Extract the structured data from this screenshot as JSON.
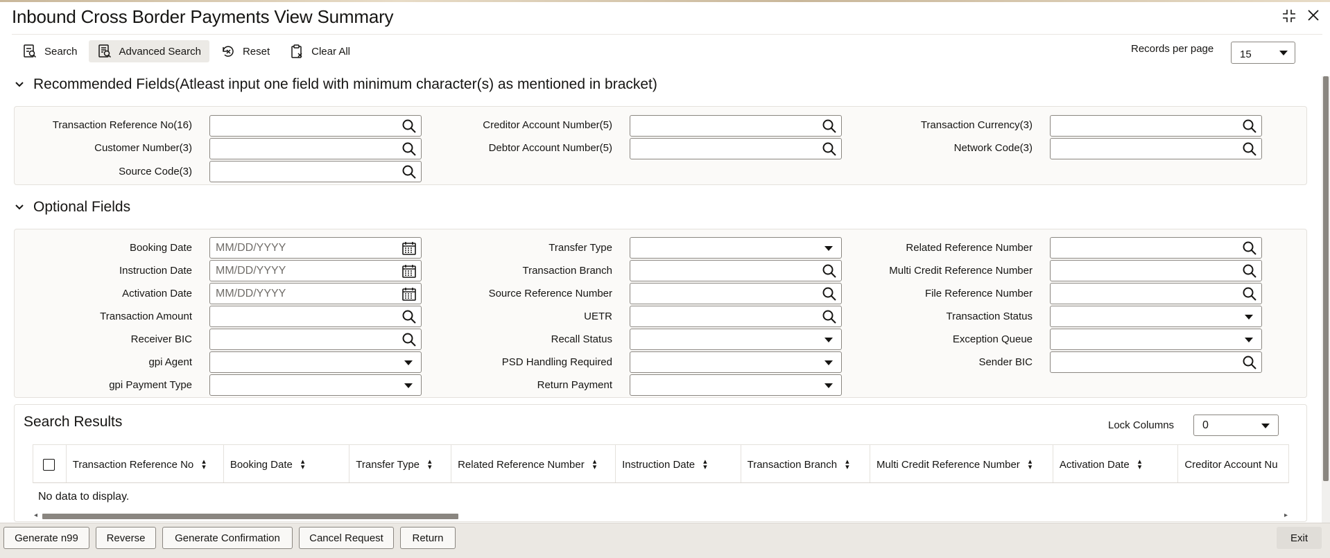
{
  "header": {
    "title": "Inbound Cross Border Payments View Summary",
    "minimize_icon": "collapse-icon",
    "close_icon": "close-icon"
  },
  "toolbar": {
    "search": "Search",
    "advanced_search": "Advanced Search",
    "reset": "Reset",
    "clear_all": "Clear All",
    "records_per_page_label": "Records per page",
    "records_per_page_value": "15"
  },
  "recommended": {
    "title": "Recommended Fields(Atleast input one field with minimum character(s) as mentioned in bracket)",
    "fields": {
      "txn_ref": "Transaction Reference No(16)",
      "customer_no": "Customer Number(3)",
      "source_code": "Source Code(3)",
      "creditor_acc": "Creditor Account Number(5)",
      "debtor_acc": "Debtor Account Number(5)",
      "txn_currency": "Transaction Currency(3)",
      "network_code": "Network Code(3)"
    }
  },
  "optional": {
    "title": "Optional Fields",
    "fields": {
      "booking_date": "Booking Date",
      "instruction_date": "Instruction Date",
      "activation_date": "Activation Date",
      "txn_amount": "Transaction Amount",
      "receiver_bic": "Receiver BIC",
      "gpi_agent": "gpi Agent",
      "gpi_payment_type": "gpi Payment Type",
      "transfer_type": "Transfer Type",
      "txn_branch": "Transaction Branch",
      "source_ref": "Source Reference Number",
      "uetr": "UETR",
      "recall_status": "Recall Status",
      "psd_handling": "PSD Handling Required",
      "return_payment": "Return Payment",
      "related_ref": "Related Reference Number",
      "multi_credit_ref": "Multi Credit Reference Number",
      "file_ref": "File Reference Number",
      "txn_status": "Transaction Status",
      "exception_queue": "Exception Queue",
      "sender_bic": "Sender BIC"
    },
    "date_placeholder": "MM/DD/YYYY"
  },
  "results": {
    "title": "Search Results",
    "lock_columns_label": "Lock Columns",
    "lock_columns_value": "0",
    "columns": [
      "Transaction Reference No",
      "Booking Date",
      "Transfer Type",
      "Related Reference Number",
      "Instruction Date",
      "Transaction Branch",
      "Multi Credit Reference Number",
      "Activation Date",
      "Creditor Account Nu"
    ],
    "empty_text": "No data to display."
  },
  "footer": {
    "generate_n99": "Generate n99",
    "reverse": "Reverse",
    "generate_confirmation": "Generate Confirmation",
    "cancel_request": "Cancel Request",
    "return": "Return",
    "exit": "Exit"
  }
}
